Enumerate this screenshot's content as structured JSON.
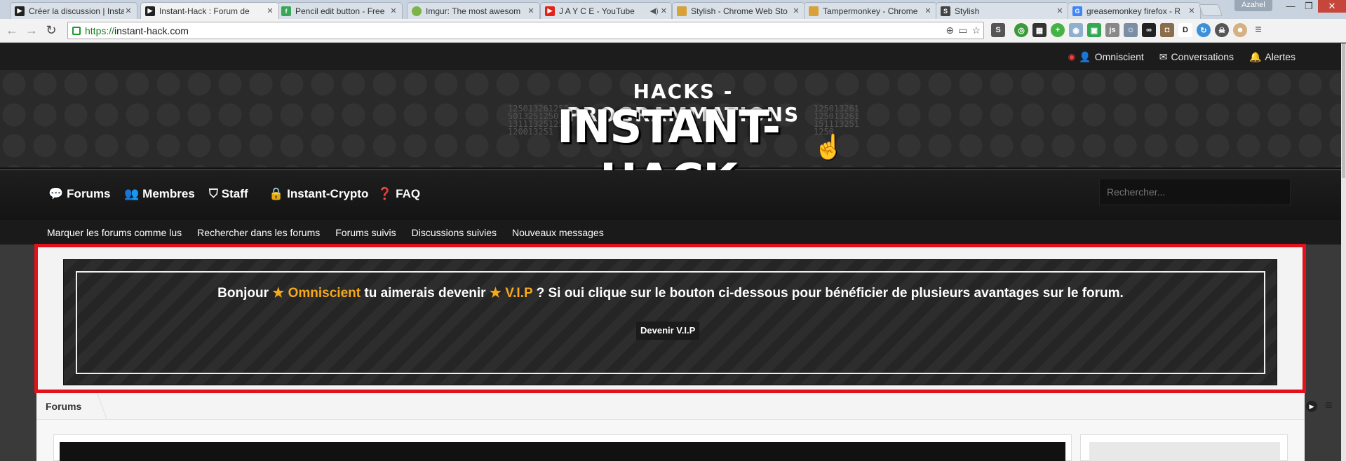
{
  "browser": {
    "tabs": [
      {
        "title": "Créer la discussion | Insta",
        "favicon": "play-icon",
        "color": "#222"
      },
      {
        "title": "Instant-Hack : Forum de",
        "favicon": "play-icon",
        "color": "#222"
      },
      {
        "title": "Pencil edit button - Free",
        "favicon": "freepik-icon",
        "color": "#3aa757"
      },
      {
        "title": "Imgur: The most awesom",
        "favicon": "imgur-icon",
        "color": "#7bb547"
      },
      {
        "title": "J A Y C E - YouTube",
        "favicon": "youtube-icon",
        "color": "#e62117"
      },
      {
        "title": "Stylish - Chrome Web Sto",
        "favicon": "chrome-store-icon",
        "color": "#d8a13a"
      },
      {
        "title": "Tampermonkey - Chrome",
        "favicon": "chrome-store-icon",
        "color": "#d8a13a"
      },
      {
        "title": "Stylish",
        "favicon": "stylish-icon",
        "color": "#444"
      },
      {
        "title": "greasemonkey firefox - R",
        "favicon": "google-icon",
        "color": "#4285f4"
      }
    ],
    "user": "Azahel",
    "url_scheme": "https://",
    "url_host": "instant-hack.com"
  },
  "site": {
    "topbar": {
      "user": "Omniscient",
      "conversations": "Conversations",
      "alerts": "Alertes"
    },
    "logo": {
      "subtitle": "HACKS - PROGRAMMATIONS",
      "title": "INSTANT-HACK"
    },
    "nav": {
      "forums": "Forums",
      "members": "Membres",
      "staff": "Staff",
      "crypto": "Instant-Crypto",
      "faq": "FAQ"
    },
    "search_placeholder": "Rechercher...",
    "subnav": [
      "Marquer les forums comme lus",
      "Rechercher dans les forums",
      "Forums suivis",
      "Discussions suivies",
      "Nouveaux messages"
    ],
    "vip": {
      "hello": "Bonjour",
      "user": "Omniscient",
      "middle": "tu aimerais devenir",
      "vip": "V.I.P",
      "rest": "? Si oui clique sur le bouton ci-dessous pour bénéficier de plusieurs avantages sur le forum.",
      "button": "Devenir V.I.P"
    },
    "breadcrumb": "Forums"
  },
  "colors": {
    "accent": "#f5a91c",
    "highlight_border": "#e5111a"
  }
}
